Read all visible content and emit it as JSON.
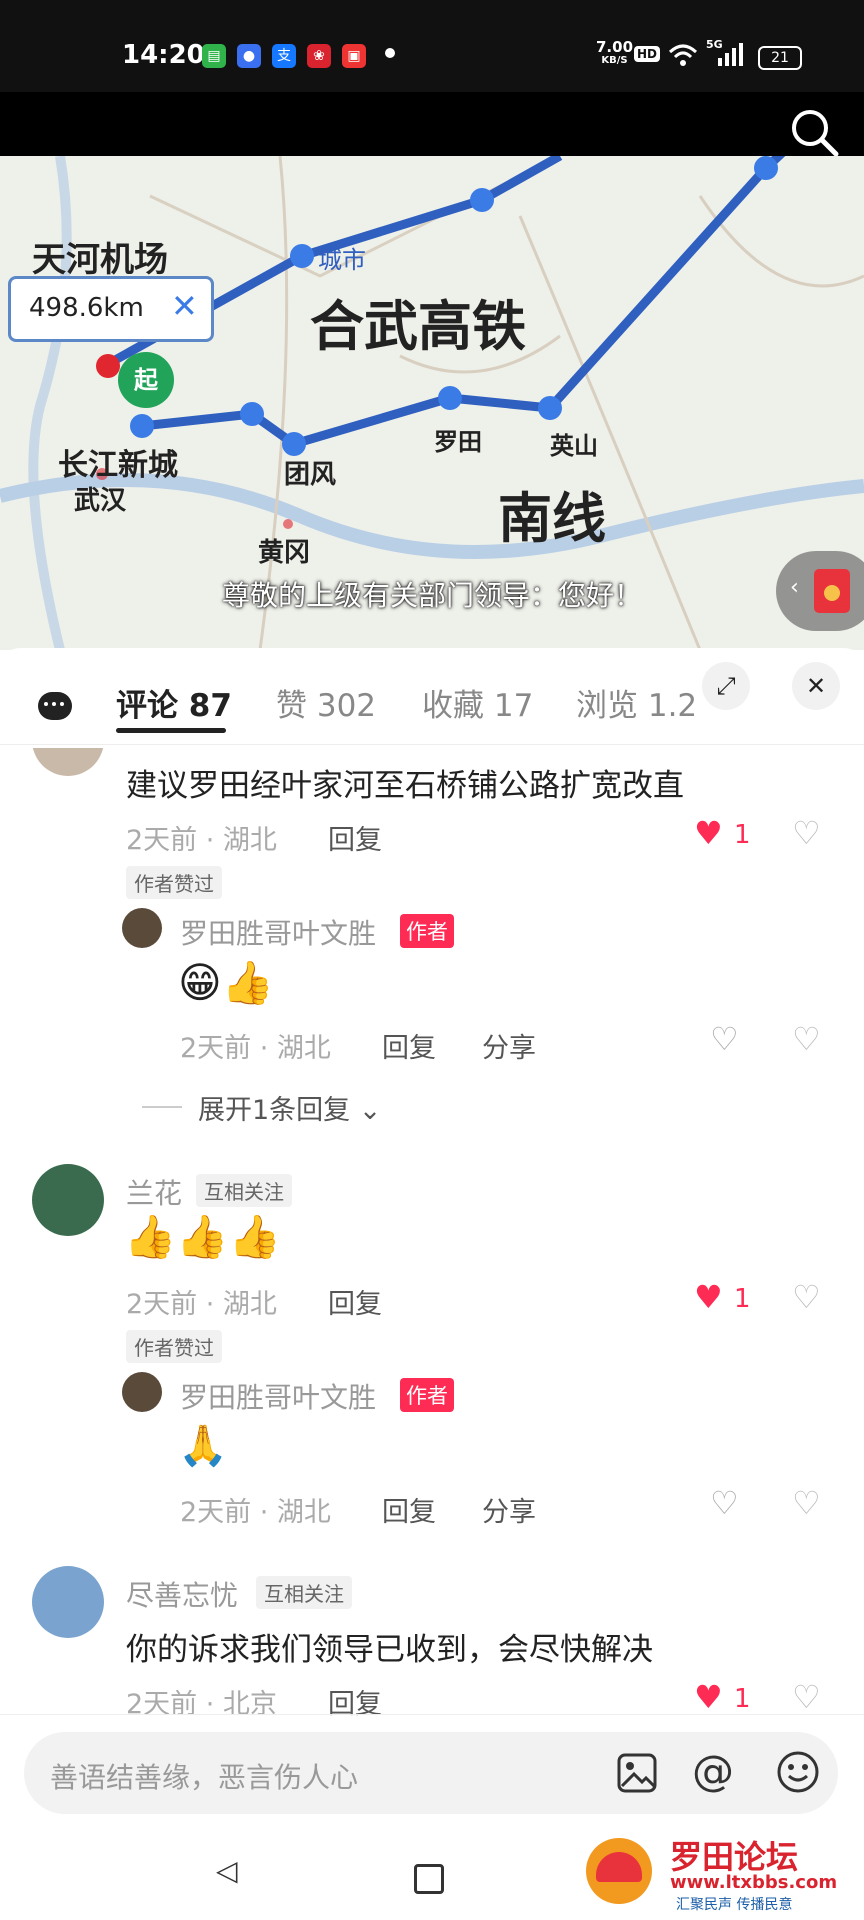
{
  "status_bar": {
    "time": "14:20",
    "net_speed": "7.00",
    "net_unit": "KB/S",
    "hd": "HD",
    "signal": "5G",
    "battery": "21"
  },
  "video": {
    "distance": "498.6km",
    "start_marker": "起",
    "places": {
      "airport": "天河机场",
      "city": "城市",
      "route_title": "合武高铁",
      "new_city": "长江新城",
      "wuhan": "武汉",
      "tuanfeng": "团风",
      "luotian": "罗田",
      "yingshan": "英山",
      "south_line": "南线",
      "huanggang": "黄冈"
    },
    "subtitle": "尊敬的上级有关部门领导：您好！"
  },
  "tabs": [
    {
      "label": "评论 87"
    },
    {
      "label": "赞 302"
    },
    {
      "label": "收藏 17"
    },
    {
      "label": "浏览 1.2"
    }
  ],
  "comments": [
    {
      "text": "建议罗田经叶家河至石桥铺公路扩宽改直",
      "meta": "2天前 · 湖北",
      "reply_label": "回复",
      "likes": "1",
      "author_liked": "作者赞过",
      "reply": {
        "name": "罗田胜哥叶文胜",
        "author_tag": "作者",
        "text": "😁👍",
        "meta": "2天前 · 湖北",
        "reply_label": "回复",
        "share_label": "分享"
      },
      "expand": "展开1条回复"
    },
    {
      "name": "兰花",
      "follow_tag": "互相关注",
      "text": "👍👍👍",
      "meta": "2天前 · 湖北",
      "reply_label": "回复",
      "likes": "1",
      "author_liked": "作者赞过",
      "reply": {
        "name": "罗田胜哥叶文胜",
        "author_tag": "作者",
        "text": "🙏",
        "meta": "2天前 · 湖北",
        "reply_label": "回复",
        "share_label": "分享"
      }
    },
    {
      "name": "尽善忘忧",
      "follow_tag": "互相关注",
      "text": "你的诉求我们领导已收到，会尽快解决",
      "meta": "2天前 · 北京",
      "reply_label": "回复",
      "likes": "1"
    }
  ],
  "input": {
    "placeholder": "善语结善缘，恶言伤人心"
  },
  "watermark": {
    "title": "罗田论坛",
    "url": "www.ltxbbs.com",
    "slogan": "汇聚民声 传播民意"
  },
  "colors": {
    "accent_red": "#fe2c55",
    "route_blue": "#2f5fbf"
  }
}
